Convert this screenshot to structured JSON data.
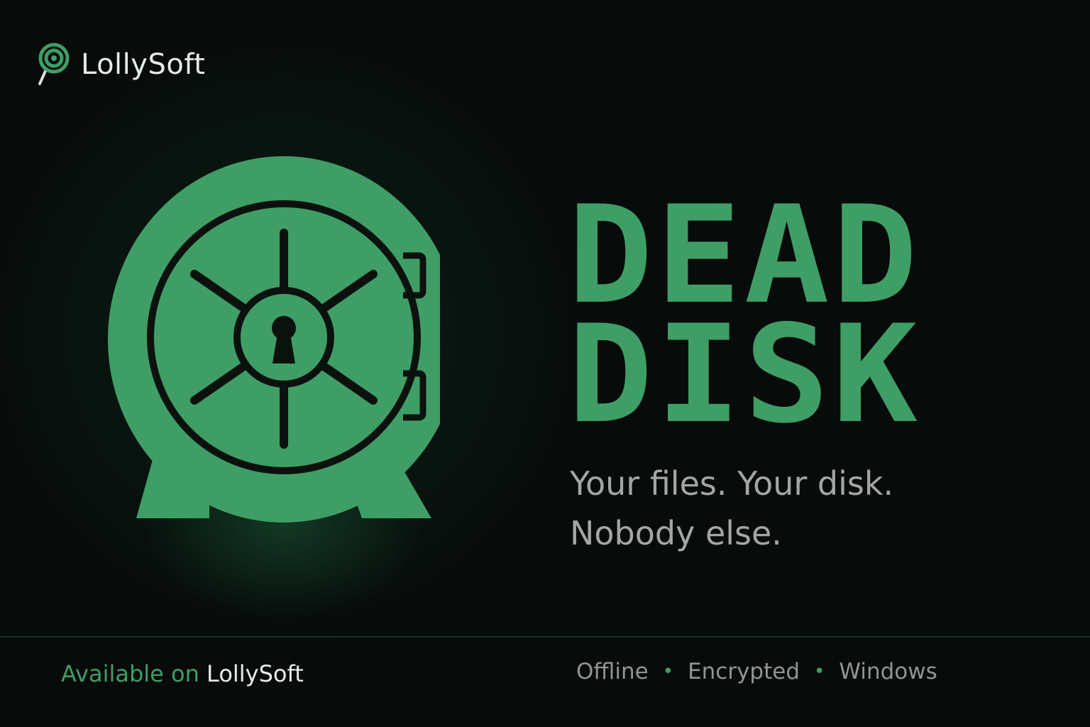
{
  "brand": {
    "name": "LollySoft",
    "logo_icon": "lollipop-icon"
  },
  "hero": {
    "icon": "vault-safe-icon",
    "title_lines": [
      "DEAD",
      "DISK"
    ],
    "tagline_lines": [
      "Your files. Your disk.",
      "Nobody else."
    ]
  },
  "footer": {
    "availability_prefix": "Available on",
    "availability_platform": "LollySoft",
    "features": [
      "Offline",
      "Encrypted",
      "Windows"
    ],
    "separator": "•"
  },
  "colors": {
    "background": "#070b0a",
    "accent": "#3f9e66",
    "text_light": "#e4ece7",
    "text_muted": "#a2a6a4"
  }
}
